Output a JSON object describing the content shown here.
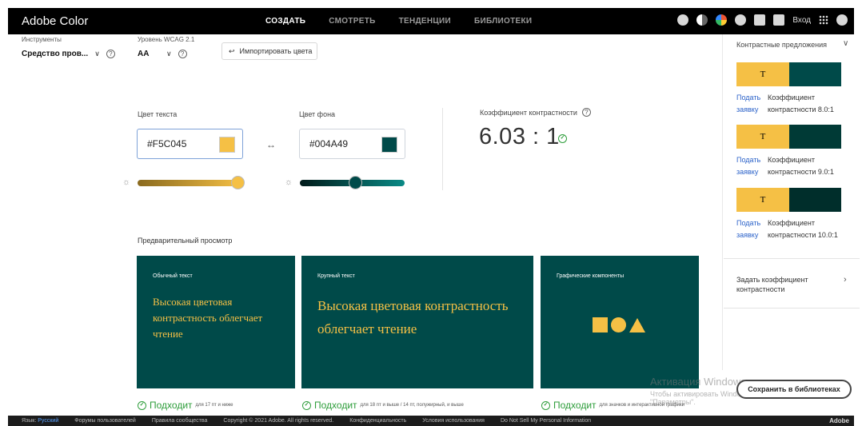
{
  "app": {
    "title": "Adobe Color"
  },
  "nav": {
    "items": [
      "СОЗДАТЬ",
      "СМОТРЕТЬ",
      "ТЕНДЕНЦИИ",
      "БИБЛИОТЕКИ"
    ],
    "active_index": 0
  },
  "header_tools": {
    "login": "Вход"
  },
  "toolbar": {
    "tools_label": "Инструменты",
    "tools_value": "Средство пров...",
    "wcag_label": "Уровень WCAG 2.1",
    "wcag_value": "AA",
    "import_label": "Импортировать цвета"
  },
  "text_color": {
    "label": "Цвет текста",
    "hex": "#F5C045",
    "swatch": "#F5C045",
    "brightness": 0.96
  },
  "bg_color": {
    "label": "Цвет фона",
    "hex": "#004A49",
    "swatch": "#004A49",
    "brightness": 0.53
  },
  "contrast": {
    "label": "Коэффициент контрастности",
    "ratio": "6.03 : 1",
    "passes": true
  },
  "preview": {
    "title": "Предварительный просмотр",
    "cards": [
      {
        "label": "Обычный текст",
        "text": "Высокая цветовая контрастность облегчает чтение"
      },
      {
        "label": "Крупный текст",
        "text": "Высокая цветовая контрастность облегчает чтение"
      },
      {
        "label": "Графические компоненты"
      }
    ],
    "results": [
      {
        "status": "Подходит",
        "note": "для 17 пт и ниже"
      },
      {
        "status": "Подходит",
        "note": "для 18 пт и выше / 14 пт, полужирный, и выше"
      },
      {
        "status": "Подходит",
        "note": "для значков и интерактивной графики"
      }
    ]
  },
  "suggestions": {
    "title": "Контрастные предложения",
    "items": [
      {
        "sample": "T",
        "fg": "#F5C045",
        "bg": "#004A49",
        "link": "Подать заявку",
        "desc": "Коэффициент контрастности 8.0:1"
      },
      {
        "sample": "T",
        "fg": "#F5C045",
        "bg": "#003A36",
        "link": "Подать заявку",
        "desc": "Коэффициент контрастности 9.0:1"
      },
      {
        "sample": "T",
        "fg": "#F5C045",
        "bg": "#002E2B",
        "link": "Подать заявку",
        "desc": "Коэффициент контрастности 10.0:1"
      }
    ],
    "set_ratio": "Задать коэффициент контрастности"
  },
  "save_button": "Сохранить в библиотеках",
  "windows_watermark": {
    "title": "Активация Windows",
    "text": "Чтобы активировать Windows, перейдите в раздел \"Параметры\"."
  },
  "footer": {
    "lang_label": "Язык:",
    "lang_value": "Русский",
    "links": [
      "Форумы пользователей",
      "Правила сообщества",
      "Copyright © 2021 Adobe. All rights reserved.",
      "Конфиденциальность",
      "Условия использования",
      "Do Not Sell My Personal Information"
    ],
    "brand": "Adobe"
  }
}
